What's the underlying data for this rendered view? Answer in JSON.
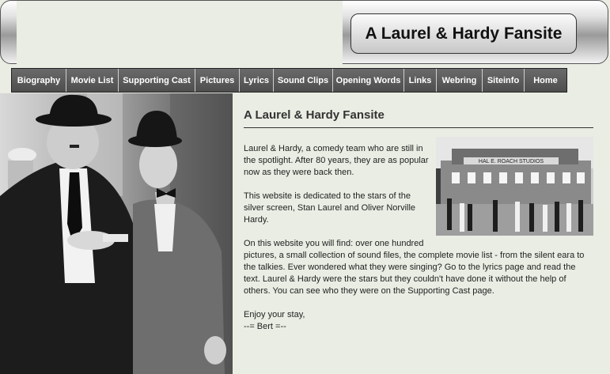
{
  "header": {
    "title": "A Laurel & Hardy Fansite"
  },
  "nav": {
    "items": [
      "Biography",
      "Movie List",
      "Supporting Cast",
      "Pictures",
      "Lyrics",
      "Sound Clips",
      "Opening Words",
      "Links",
      "Webring",
      "Siteinfo",
      "Home"
    ]
  },
  "main": {
    "heading": "A Laurel & Hardy Fansite",
    "paragraphs": [
      "Laurel & Hardy, a comedy team who are still in the spotlight. After 80 years, they are as popular now as they were back then.",
      "This website is dedicated to the stars of the silver screen, Stan Laurel and Oliver Norville Hardy.",
      "On this website you will find: over one hundred pictures, a small collection of sound files, the complete movie list - from the silent eara to the talkies. Ever wondered what they were singing? Go to the lyrics page and read the text. Laurel & Hardy were the stars but they couldn't have done it without the help of others. You can see who they were on the Supporting Cast page."
    ],
    "closing": "Enjoy your stay,",
    "signature": "--= Bert =--",
    "studio_sign": "HAL E. ROACH STUDIOS"
  },
  "colors": {
    "page_bg": "#e9ede3",
    "nav_bg": "#595959",
    "nav_text": "#ffffff",
    "text": "#222222"
  },
  "icons": [
    "laurel-hardy-photo",
    "roach-studios-photo"
  ]
}
